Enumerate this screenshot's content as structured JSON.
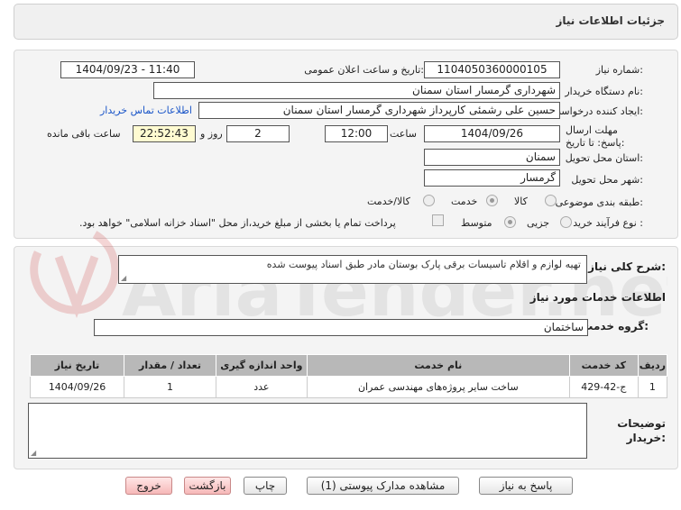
{
  "header": {
    "title": "جزئیات اطلاعات نیاز"
  },
  "form": {
    "need_number_label": "شماره نیاز:",
    "need_number": "1104050360000105",
    "announce_label": "تاریخ و ساعت اعلان عمومی:",
    "announce_value": "1404/09/23 - 11:40",
    "buyer_org_label": "نام دستگاه خریدار:",
    "buyer_org": "شهرداری گرمسار استان سمنان",
    "creator_label": "ایجاد کننده درخواست:",
    "creator": "حسین علی رشمئی کارپرداز شهرداری گرمسار استان سمنان",
    "contact_link": "اطلاعات تماس خریدار",
    "deadline_label": "مهلت ارسال پاسخ: تا تاریخ:",
    "deadline_date": "1404/09/26",
    "time_label": "ساعت",
    "deadline_time": "12:00",
    "days_value": "2",
    "days_label": "روز و",
    "remaining_time": "22:52:43",
    "remaining_label": "ساعت باقی مانده",
    "province_label": "استان محل تحویل:",
    "province": "سمنان",
    "city_label": "شهر محل تحویل:",
    "city": "گرمسار",
    "category_label": "طبقه بندی موضوعی:",
    "category_options": [
      "کالا",
      "خدمت",
      "کالا/خدمت"
    ],
    "category_selected": "خدمت",
    "process_label": "نوع فرآیند خرید :",
    "process_options": [
      "جزیی",
      "متوسط"
    ],
    "process_selected": "متوسط",
    "payment_note": "پرداخت تمام یا بخشی از مبلغ خرید،از محل \"اسناد خزانه اسلامی\" خواهد بود."
  },
  "details": {
    "description_label": "شرح کلی نیاز:",
    "description": "تهیه لوازم و اقلام تاسیسات برقی پارک بوستان مادر طبق اسناد پیوست شده",
    "services_heading": "اطلاعات خدمات مورد نیاز",
    "service_group_label": "گروه خدمت:",
    "service_group": "ساختمان",
    "table": {
      "headers": [
        "ردیف",
        "کد خدمت",
        "نام خدمت",
        "واحد اندازه گیری",
        "تعداد / مقدار",
        "تاریخ نیاز"
      ],
      "rows": [
        [
          "1",
          "ج-42-429",
          "ساخت سایر پروژه‌های مهندسی عمران",
          "عدد",
          "1",
          "1404/09/26"
        ]
      ]
    },
    "buyer_notes_label": "توضیحات خریدار:",
    "buyer_notes": ""
  },
  "buttons": {
    "reply": "پاسخ به نیاز",
    "attachments": "مشاهده مدارک پیوستی (1)",
    "print": "چاپ",
    "back": "بازگشت",
    "exit": "خروج"
  },
  "watermark": {
    "text": "AriaTender.net"
  },
  "colors": {
    "accent_link": "#1a55c8",
    "remaining_bg": "#fffbd1",
    "table_header": "#b8b8b8"
  }
}
